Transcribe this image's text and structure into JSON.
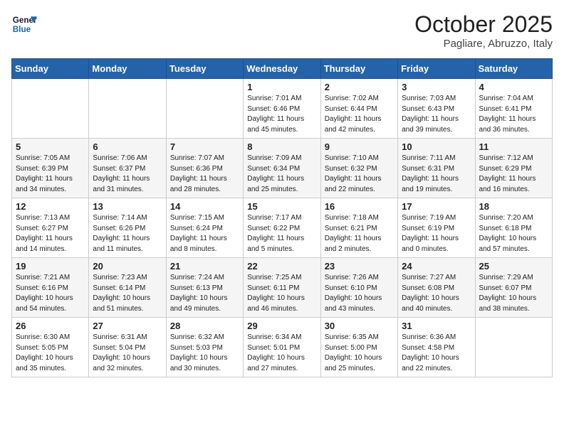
{
  "logo": {
    "line1": "General",
    "line2": "Blue"
  },
  "title": "October 2025",
  "location": "Pagliare, Abruzzo, Italy",
  "weekdays": [
    "Sunday",
    "Monday",
    "Tuesday",
    "Wednesday",
    "Thursday",
    "Friday",
    "Saturday"
  ],
  "weeks": [
    [
      {
        "day": "",
        "sunrise": "",
        "sunset": "",
        "daylight": ""
      },
      {
        "day": "",
        "sunrise": "",
        "sunset": "",
        "daylight": ""
      },
      {
        "day": "",
        "sunrise": "",
        "sunset": "",
        "daylight": ""
      },
      {
        "day": "1",
        "sunrise": "Sunrise: 7:01 AM",
        "sunset": "Sunset: 6:46 PM",
        "daylight": "Daylight: 11 hours and 45 minutes."
      },
      {
        "day": "2",
        "sunrise": "Sunrise: 7:02 AM",
        "sunset": "Sunset: 6:44 PM",
        "daylight": "Daylight: 11 hours and 42 minutes."
      },
      {
        "day": "3",
        "sunrise": "Sunrise: 7:03 AM",
        "sunset": "Sunset: 6:43 PM",
        "daylight": "Daylight: 11 hours and 39 minutes."
      },
      {
        "day": "4",
        "sunrise": "Sunrise: 7:04 AM",
        "sunset": "Sunset: 6:41 PM",
        "daylight": "Daylight: 11 hours and 36 minutes."
      }
    ],
    [
      {
        "day": "5",
        "sunrise": "Sunrise: 7:05 AM",
        "sunset": "Sunset: 6:39 PM",
        "daylight": "Daylight: 11 hours and 34 minutes."
      },
      {
        "day": "6",
        "sunrise": "Sunrise: 7:06 AM",
        "sunset": "Sunset: 6:37 PM",
        "daylight": "Daylight: 11 hours and 31 minutes."
      },
      {
        "day": "7",
        "sunrise": "Sunrise: 7:07 AM",
        "sunset": "Sunset: 6:36 PM",
        "daylight": "Daylight: 11 hours and 28 minutes."
      },
      {
        "day": "8",
        "sunrise": "Sunrise: 7:09 AM",
        "sunset": "Sunset: 6:34 PM",
        "daylight": "Daylight: 11 hours and 25 minutes."
      },
      {
        "day": "9",
        "sunrise": "Sunrise: 7:10 AM",
        "sunset": "Sunset: 6:32 PM",
        "daylight": "Daylight: 11 hours and 22 minutes."
      },
      {
        "day": "10",
        "sunrise": "Sunrise: 7:11 AM",
        "sunset": "Sunset: 6:31 PM",
        "daylight": "Daylight: 11 hours and 19 minutes."
      },
      {
        "day": "11",
        "sunrise": "Sunrise: 7:12 AM",
        "sunset": "Sunset: 6:29 PM",
        "daylight": "Daylight: 11 hours and 16 minutes."
      }
    ],
    [
      {
        "day": "12",
        "sunrise": "Sunrise: 7:13 AM",
        "sunset": "Sunset: 6:27 PM",
        "daylight": "Daylight: 11 hours and 14 minutes."
      },
      {
        "day": "13",
        "sunrise": "Sunrise: 7:14 AM",
        "sunset": "Sunset: 6:26 PM",
        "daylight": "Daylight: 11 hours and 11 minutes."
      },
      {
        "day": "14",
        "sunrise": "Sunrise: 7:15 AM",
        "sunset": "Sunset: 6:24 PM",
        "daylight": "Daylight: 11 hours and 8 minutes."
      },
      {
        "day": "15",
        "sunrise": "Sunrise: 7:17 AM",
        "sunset": "Sunset: 6:22 PM",
        "daylight": "Daylight: 11 hours and 5 minutes."
      },
      {
        "day": "16",
        "sunrise": "Sunrise: 7:18 AM",
        "sunset": "Sunset: 6:21 PM",
        "daylight": "Daylight: 11 hours and 2 minutes."
      },
      {
        "day": "17",
        "sunrise": "Sunrise: 7:19 AM",
        "sunset": "Sunset: 6:19 PM",
        "daylight": "Daylight: 11 hours and 0 minutes."
      },
      {
        "day": "18",
        "sunrise": "Sunrise: 7:20 AM",
        "sunset": "Sunset: 6:18 PM",
        "daylight": "Daylight: 10 hours and 57 minutes."
      }
    ],
    [
      {
        "day": "19",
        "sunrise": "Sunrise: 7:21 AM",
        "sunset": "Sunset: 6:16 PM",
        "daylight": "Daylight: 10 hours and 54 minutes."
      },
      {
        "day": "20",
        "sunrise": "Sunrise: 7:23 AM",
        "sunset": "Sunset: 6:14 PM",
        "daylight": "Daylight: 10 hours and 51 minutes."
      },
      {
        "day": "21",
        "sunrise": "Sunrise: 7:24 AM",
        "sunset": "Sunset: 6:13 PM",
        "daylight": "Daylight: 10 hours and 49 minutes."
      },
      {
        "day": "22",
        "sunrise": "Sunrise: 7:25 AM",
        "sunset": "Sunset: 6:11 PM",
        "daylight": "Daylight: 10 hours and 46 minutes."
      },
      {
        "day": "23",
        "sunrise": "Sunrise: 7:26 AM",
        "sunset": "Sunset: 6:10 PM",
        "daylight": "Daylight: 10 hours and 43 minutes."
      },
      {
        "day": "24",
        "sunrise": "Sunrise: 7:27 AM",
        "sunset": "Sunset: 6:08 PM",
        "daylight": "Daylight: 10 hours and 40 minutes."
      },
      {
        "day": "25",
        "sunrise": "Sunrise: 7:29 AM",
        "sunset": "Sunset: 6:07 PM",
        "daylight": "Daylight: 10 hours and 38 minutes."
      }
    ],
    [
      {
        "day": "26",
        "sunrise": "Sunrise: 6:30 AM",
        "sunset": "Sunset: 5:05 PM",
        "daylight": "Daylight: 10 hours and 35 minutes."
      },
      {
        "day": "27",
        "sunrise": "Sunrise: 6:31 AM",
        "sunset": "Sunset: 5:04 PM",
        "daylight": "Daylight: 10 hours and 32 minutes."
      },
      {
        "day": "28",
        "sunrise": "Sunrise: 6:32 AM",
        "sunset": "Sunset: 5:03 PM",
        "daylight": "Daylight: 10 hours and 30 minutes."
      },
      {
        "day": "29",
        "sunrise": "Sunrise: 6:34 AM",
        "sunset": "Sunset: 5:01 PM",
        "daylight": "Daylight: 10 hours and 27 minutes."
      },
      {
        "day": "30",
        "sunrise": "Sunrise: 6:35 AM",
        "sunset": "Sunset: 5:00 PM",
        "daylight": "Daylight: 10 hours and 25 minutes."
      },
      {
        "day": "31",
        "sunrise": "Sunrise: 6:36 AM",
        "sunset": "Sunset: 4:58 PM",
        "daylight": "Daylight: 10 hours and 22 minutes."
      },
      {
        "day": "",
        "sunrise": "",
        "sunset": "",
        "daylight": ""
      }
    ]
  ]
}
